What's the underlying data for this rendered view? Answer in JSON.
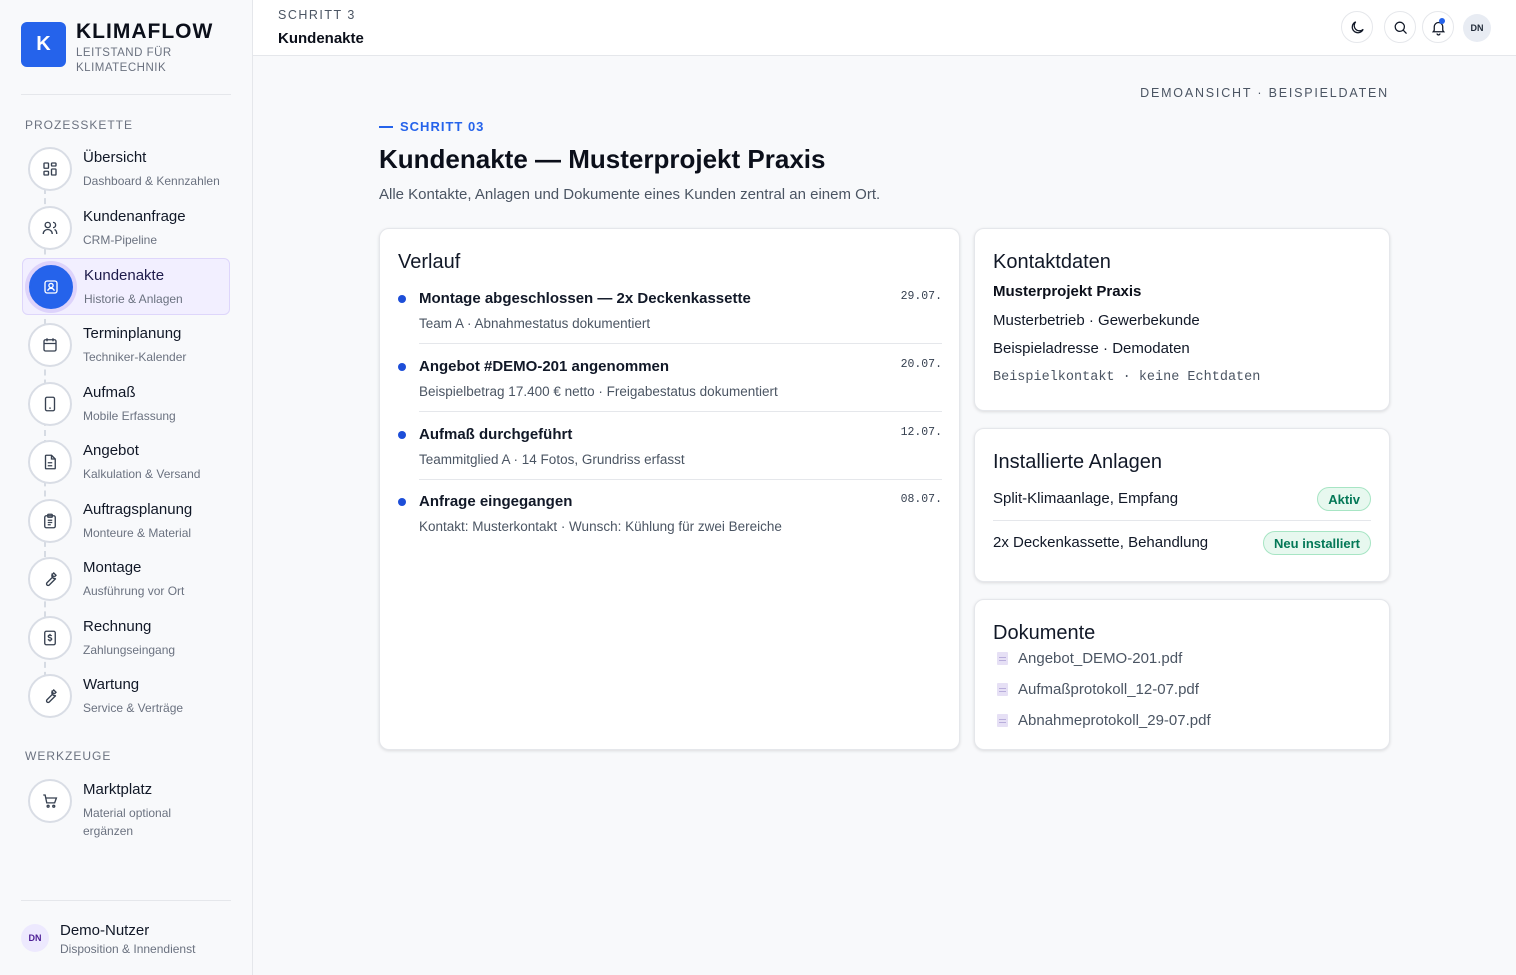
{
  "brand": {
    "logo_letter": "K",
    "name": "KLIMAFLOW",
    "subtitle": "LEITSTAND FÜR KLIMATECHNIK",
    "accent_color": "#2563eb"
  },
  "sidebar": {
    "section_process": "PROZESSKETTE",
    "section_tools": "WERKZEUGE",
    "items": [
      {
        "label": "Übersicht",
        "sub": "Dashboard & Kennzahlen",
        "icon": "grid-icon"
      },
      {
        "label": "Kundenanfrage",
        "sub": "CRM-Pipeline",
        "icon": "users-icon"
      },
      {
        "label": "Kundenakte",
        "sub": "Historie & Anlagen",
        "icon": "contact-card-icon",
        "active": true
      },
      {
        "label": "Terminplanung",
        "sub": "Techniker-Kalender",
        "icon": "calendar-icon"
      },
      {
        "label": "Aufmaß",
        "sub": "Mobile Erfassung",
        "icon": "tablet-icon"
      },
      {
        "label": "Angebot",
        "sub": "Kalkulation & Versand",
        "icon": "document-icon"
      },
      {
        "label": "Auftragsplanung",
        "sub": "Monteure & Material",
        "icon": "clipboard-icon"
      },
      {
        "label": "Montage",
        "sub": "Ausführung vor Ort",
        "icon": "wrench-icon"
      },
      {
        "label": "Rechnung",
        "sub": "Zahlungseingang",
        "icon": "invoice-icon"
      },
      {
        "label": "Wartung",
        "sub": "Service & Verträge",
        "icon": "wrench-icon"
      }
    ],
    "tools": [
      {
        "label": "Marktplatz",
        "sub": "Material optional ergänzen",
        "icon": "cart-icon"
      }
    ],
    "user": {
      "initials": "DN",
      "name": "Demo-Nutzer",
      "role": "Disposition & Innendienst"
    }
  },
  "header": {
    "step": "SCHRITT 3",
    "title": "Kundenakte",
    "avatar_initials": "DN"
  },
  "main": {
    "demo_note": "DEMOANSICHT · BEISPIELDATEN",
    "kicker": "SCHRITT 03",
    "title": "Kundenakte — Musterprojekt Praxis",
    "description": "Alle Kontakte, Anlagen und Dokumente eines Kunden zentral an einem Ort."
  },
  "verlauf": {
    "title": "Verlauf",
    "entries": [
      {
        "title": "Montage abgeschlossen — 2x Deckenkassette",
        "sub": "Team A · Abnahmestatus dokumentiert",
        "date": "29.07."
      },
      {
        "title": "Angebot #DEMO-201 angenommen",
        "sub": "Beispielbetrag 17.400 € netto · Freigabestatus dokumentiert",
        "date": "20.07."
      },
      {
        "title": "Aufmaß durchgeführt",
        "sub": "Teammitglied A · 14 Fotos, Grundriss erfasst",
        "date": "12.07."
      },
      {
        "title": "Anfrage eingegangen",
        "sub": "Kontakt: Musterkontakt · Wunsch: Kühlung für zwei Bereiche",
        "date": "08.07."
      }
    ]
  },
  "kontakt": {
    "title": "Kontaktdaten",
    "name": "Musterprojekt Praxis",
    "line1": "Musterbetrieb · Gewerbekunde",
    "line2": "Beispieladresse · Demodaten",
    "note": "Beispielkontakt · keine Echtdaten"
  },
  "anlagen": {
    "title": "Installierte Anlagen",
    "items": [
      {
        "label": "Split-Klimaanlage, Empfang",
        "status": "Aktiv"
      },
      {
        "label": "2x Deckenkassette, Behandlung",
        "status": "Neu installiert"
      }
    ],
    "status_color": "#047857"
  },
  "dokumente": {
    "title": "Dokumente",
    "files": [
      "Angebot_DEMO-201.pdf",
      "Aufmaßprotokoll_12-07.pdf",
      "Abnahmeprotokoll_29-07.pdf"
    ]
  }
}
